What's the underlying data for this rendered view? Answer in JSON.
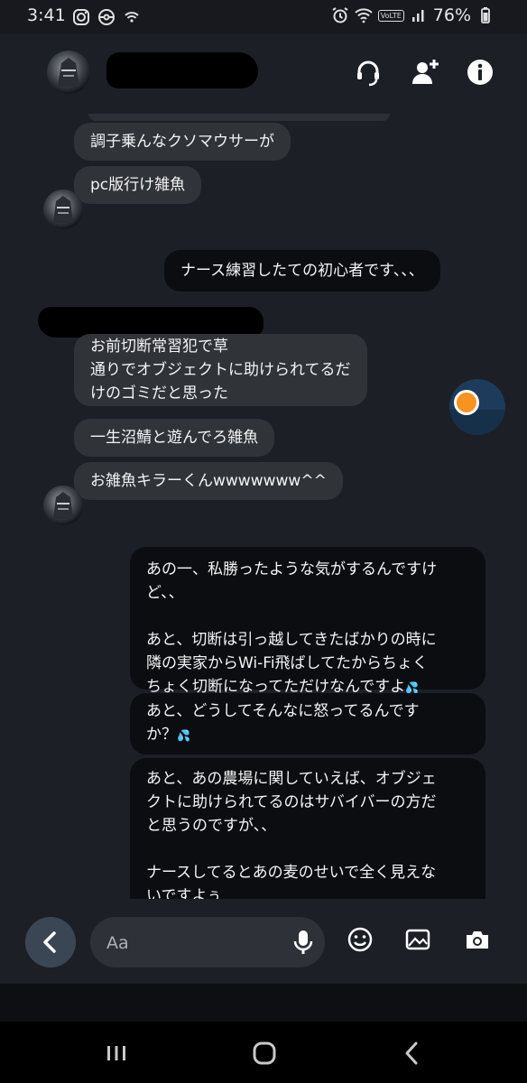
{
  "status_bar": {
    "time": "3:41",
    "volte": "VoLTE",
    "battery": "76%"
  },
  "header": {
    "icons": [
      "avatar",
      "headset-icon",
      "add-person-icon",
      "info-icon"
    ]
  },
  "messages": [
    {
      "side": "in",
      "text": "調子乗んなクソマウサーが"
    },
    {
      "side": "in",
      "text": "pc版行け雑魚"
    },
    {
      "side": "out",
      "text": "ナース練習したての初心者です、、、"
    },
    {
      "side": "in",
      "text": "お前切断常習犯で草\n通りでオブジェクトに助けられてるだ\nけのゴミだと思った"
    },
    {
      "side": "in",
      "text": "一生沼鯖と遊んでろ雑魚"
    },
    {
      "side": "in",
      "text": "お雑魚キラーくんwwwwwww^^"
    },
    {
      "side": "out",
      "text": "あの一、私勝ったような気がするんですけ\nど、、\n\nあと、切断は引っ越してきたばかりの時に\n隣の実家からWi-Fi飛ばしてたからちょく\nちょく切断になってただけなんですよ"
    },
    {
      "side": "out",
      "text": "あと、どうしてそんなに怒ってるんです\nか？"
    },
    {
      "side": "out",
      "text": "あと、あの農場に関していえば、オブジェ\nクトに助けられてるのはサバイバーの方だ\nと思うのですが、、\n\nナースしてるとあの麦のせいで全く見えな\nいですよぅ"
    }
  ],
  "emoji": "💦",
  "composer": {
    "placeholder": "Aa"
  },
  "colors": {
    "background": "#1c1f26",
    "incoming_bubble": "#303338",
    "outgoing_bubble": "#0b0d11",
    "back_button": "#3b4654"
  }
}
